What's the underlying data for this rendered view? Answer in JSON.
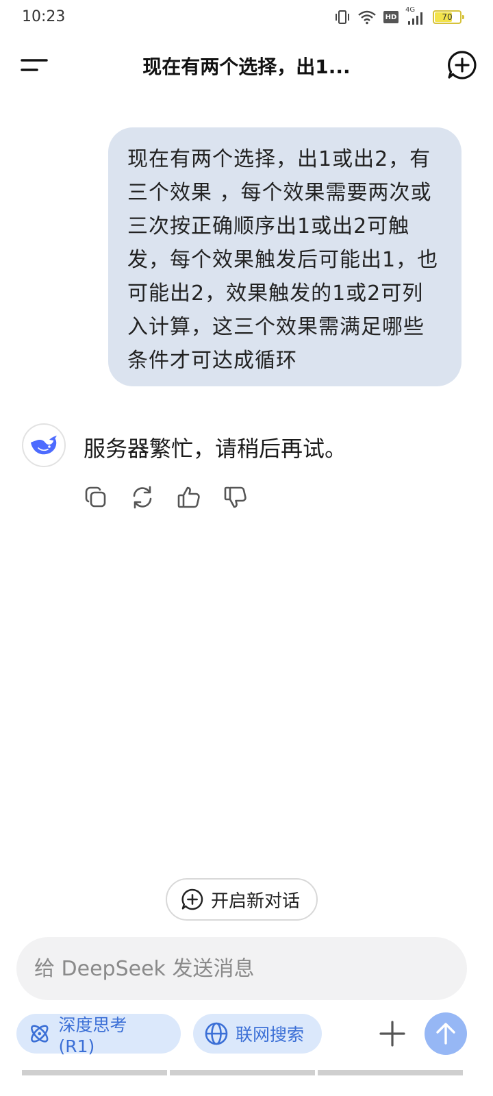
{
  "status_bar": {
    "time": "10:23",
    "hd_label": "HD",
    "network_label": "4G",
    "battery_level": "70",
    "battery_percent": 70
  },
  "header": {
    "title": "现在有两个选择，出1..."
  },
  "conversation": {
    "user_message": "现在有两个选择，出1或出2，有三个效果 ，每个效果需要两次或三次按正确顺序出1或出2可触发，每个效果触发后可能出1，也可能出2，效果触发的1或2可列入计算，这三个效果需满足哪些条件才可达成循环",
    "assistant_message": "服务器繁忙，请稍后再试。"
  },
  "new_dialog": {
    "label": "开启新对话"
  },
  "composer": {
    "placeholder": "给 DeepSeek 发送消息",
    "deep_think_label": "深度思考 (R1)",
    "web_search_label": "联网搜索"
  },
  "colors": {
    "accent": "#3b6fd6",
    "bubble": "#dbe3ef",
    "send_button": "#96b7f5",
    "avatar_whale": "#4d6bfe"
  }
}
